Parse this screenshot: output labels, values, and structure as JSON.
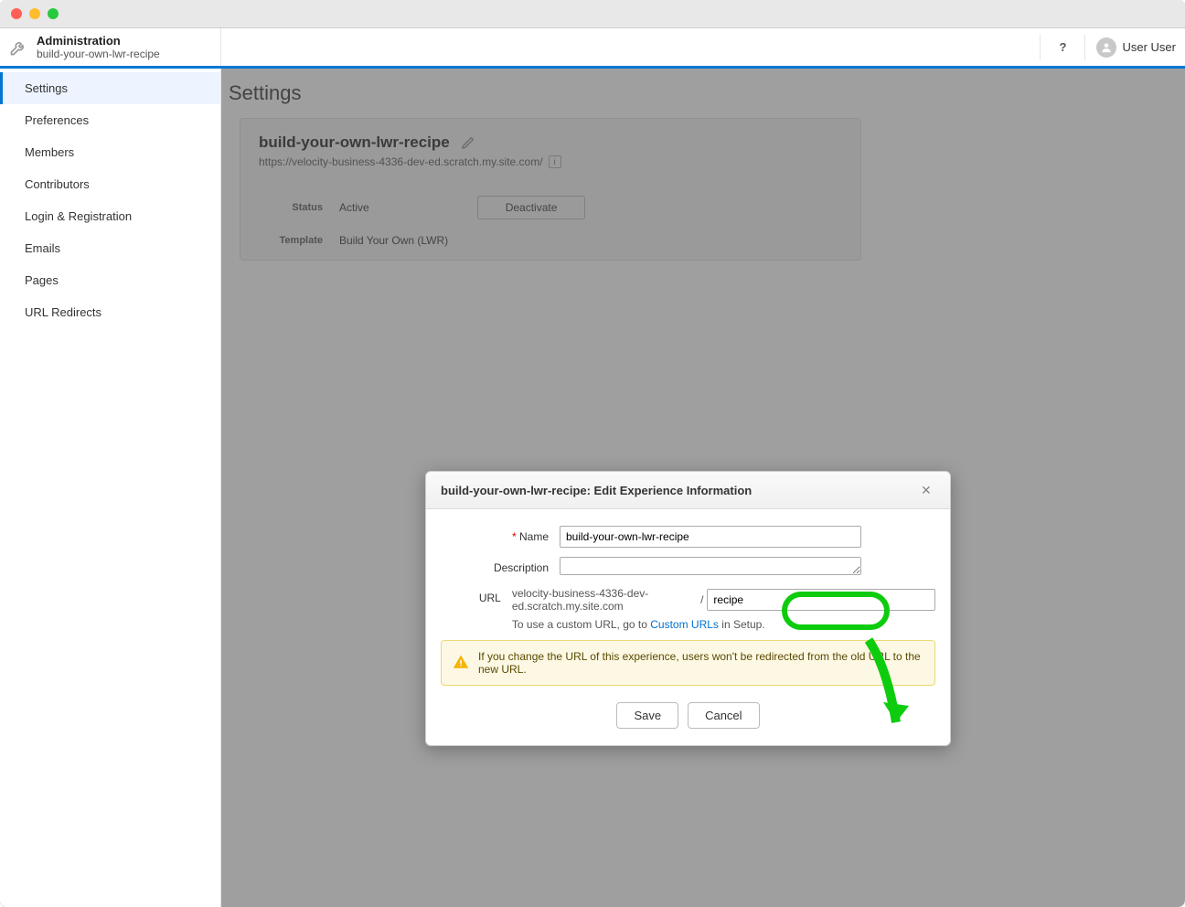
{
  "topbar": {
    "title": "Administration",
    "subtitle": "build-your-own-lwr-recipe",
    "user_name": "User User",
    "help_symbol": "?"
  },
  "sidebar": {
    "items": [
      {
        "label": "Settings"
      },
      {
        "label": "Preferences"
      },
      {
        "label": "Members"
      },
      {
        "label": "Contributors"
      },
      {
        "label": "Login & Registration"
      },
      {
        "label": "Emails"
      },
      {
        "label": "Pages"
      },
      {
        "label": "URL Redirects"
      }
    ]
  },
  "main": {
    "title": "Settings",
    "card": {
      "title": "build-your-own-lwr-recipe",
      "url": "https://velocity-business-4336-dev-ed.scratch.my.site.com/",
      "info_symbol": "i",
      "status_label": "Status",
      "status_value": "Active",
      "deactivate_label": "Deactivate",
      "template_label": "Template",
      "template_value": "Build Your Own (LWR)"
    }
  },
  "modal": {
    "title": "build-your-own-lwr-recipe: Edit Experience Information",
    "close_symbol": "✕",
    "name_label": "Name",
    "name_value": "build-your-own-lwr-recipe",
    "description_label": "Description",
    "description_value": "",
    "url_label": "URL",
    "url_domain": "velocity-business-4336-dev-ed.scratch.my.site.com",
    "url_slash": "/",
    "url_value": "recipe",
    "hint_prefix": "To use a custom URL, go to ",
    "hint_link": "Custom URLs",
    "hint_suffix": " in Setup.",
    "warning_text": "If you change the URL of this experience, users won't be redirected from the old URL to the new URL.",
    "save_label": "Save",
    "cancel_label": "Cancel"
  }
}
